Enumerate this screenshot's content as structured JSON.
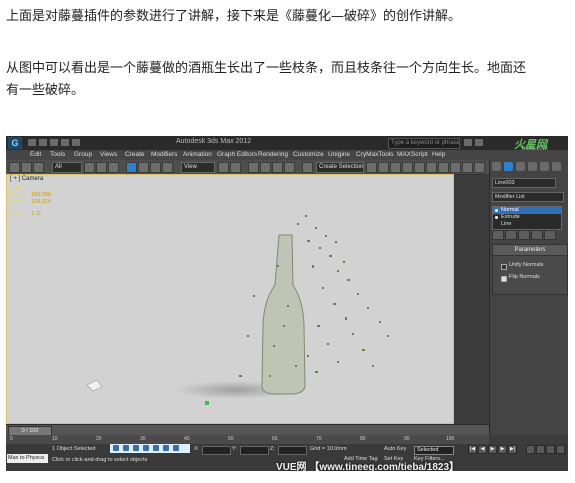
{
  "article": {
    "p1": "上面是对藤蔓插件的参数进行了讲解，接下来是《藤蔓化—破碎》的创作讲解。",
    "p2_line1": "从图中可以看出是一个藤蔓做的酒瓶生长出了一些枝条，而且枝条往一个方向生长。地面还",
    "p2_line2": "有一些破碎。"
  },
  "app": {
    "logo_text": "G",
    "window_title": "Autodesk 3ds Max 2012",
    "search_placeholder": "Type a keyword or phrase",
    "watermark_logo": "火星网",
    "watermark_url": "hxsd.com"
  },
  "menu": [
    "Edit",
    "Tools",
    "Group",
    "Views",
    "Create",
    "Modifiers",
    "Animation",
    "Graph Editors",
    "Rendering",
    "Customize",
    "Unigine",
    "CryMaxTools",
    "MAXScript",
    "Help"
  ],
  "toolbar": {
    "filter_value": "All",
    "view_value": "View",
    "selection_set_placeholder": "Create Selection Se"
  },
  "viewport": {
    "label": "[ + ] Camera",
    "stats": [
      {
        "label": "Total",
        "value": ""
      },
      {
        "label": "Polys:",
        "value": "158,688"
      },
      {
        "label": "Verts:",
        "value": "128,924"
      },
      {
        "label": "FPS:",
        "value": "1.11"
      }
    ]
  },
  "command_panel": {
    "object_name": "Line003",
    "modifier_list": "Modifier List",
    "stack": [
      "Normal",
      "Extrude",
      "Line"
    ],
    "rollout_title": "Parameters",
    "options": [
      {
        "label": "Unify Normals",
        "checked": false
      },
      {
        "label": "Flip Normals",
        "checked": true
      }
    ],
    "colors": {
      "swatch": "#38c038",
      "selection": "#2f6fb8"
    }
  },
  "timeline": {
    "slider": "0 / 100",
    "ticks": [
      "0",
      "10",
      "20",
      "30",
      "40",
      "50",
      "60",
      "70",
      "80",
      "90",
      "100"
    ]
  },
  "status": {
    "maxscript_text": "Max to Physca",
    "selected": "1 Object Selected",
    "prompt": "Click or click-and-drag to select objects",
    "x_label": "X:",
    "y_label": "Y:",
    "z_label": "Z:",
    "grid": "Grid = 10.0mm",
    "add_time_tag": "Add Time Tag",
    "auto_key": "Auto Key",
    "auto_key_value": "Selected",
    "set_key": "Set Key",
    "key_filters": "Key Filters..."
  },
  "footer_watermark": "VUE网 【www.tineeg.com/tieba/1823】"
}
